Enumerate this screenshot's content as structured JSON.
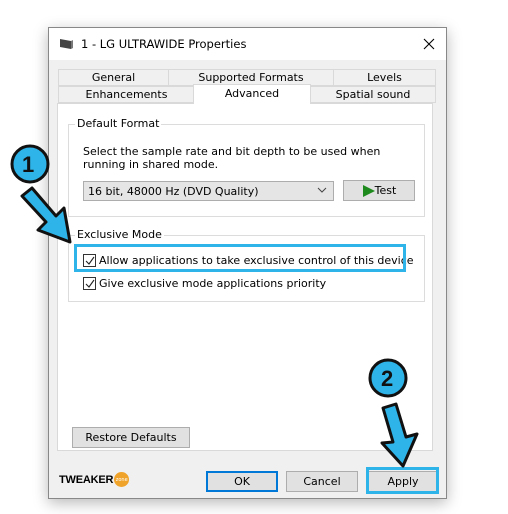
{
  "window": {
    "title": "1 - LG ULTRAWIDE Properties",
    "icon": "speaker-device-icon",
    "close_icon": "close-icon"
  },
  "tabs": {
    "row1": [
      {
        "label": "General"
      },
      {
        "label": "Supported Formats"
      },
      {
        "label": "Levels"
      }
    ],
    "row2": [
      {
        "label": "Enhancements"
      },
      {
        "label": "Advanced",
        "selected": true
      },
      {
        "label": "Spatial sound"
      }
    ]
  },
  "default_format": {
    "group_label": "Default Format",
    "description": "Select the sample rate and bit depth to be used when running in shared mode.",
    "selected_format": "16 bit, 48000 Hz (DVD Quality)",
    "test_label": "Test",
    "test_icon": "play-icon"
  },
  "exclusive_mode": {
    "group_label": "Exclusive Mode",
    "options": [
      {
        "label": "Allow applications to take exclusive control of this device",
        "checked": true
      },
      {
        "label": "Give exclusive mode applications priority",
        "checked": true
      }
    ]
  },
  "restore_defaults_label": "Restore Defaults",
  "footer": {
    "ok_label": "OK",
    "cancel_label": "Cancel",
    "apply_label": "Apply",
    "logo_text": "TWEAKER",
    "logo_badge": "zone"
  },
  "annotations": {
    "step1": "1",
    "step2": "2",
    "highlight_color": "#2eb4e8"
  }
}
